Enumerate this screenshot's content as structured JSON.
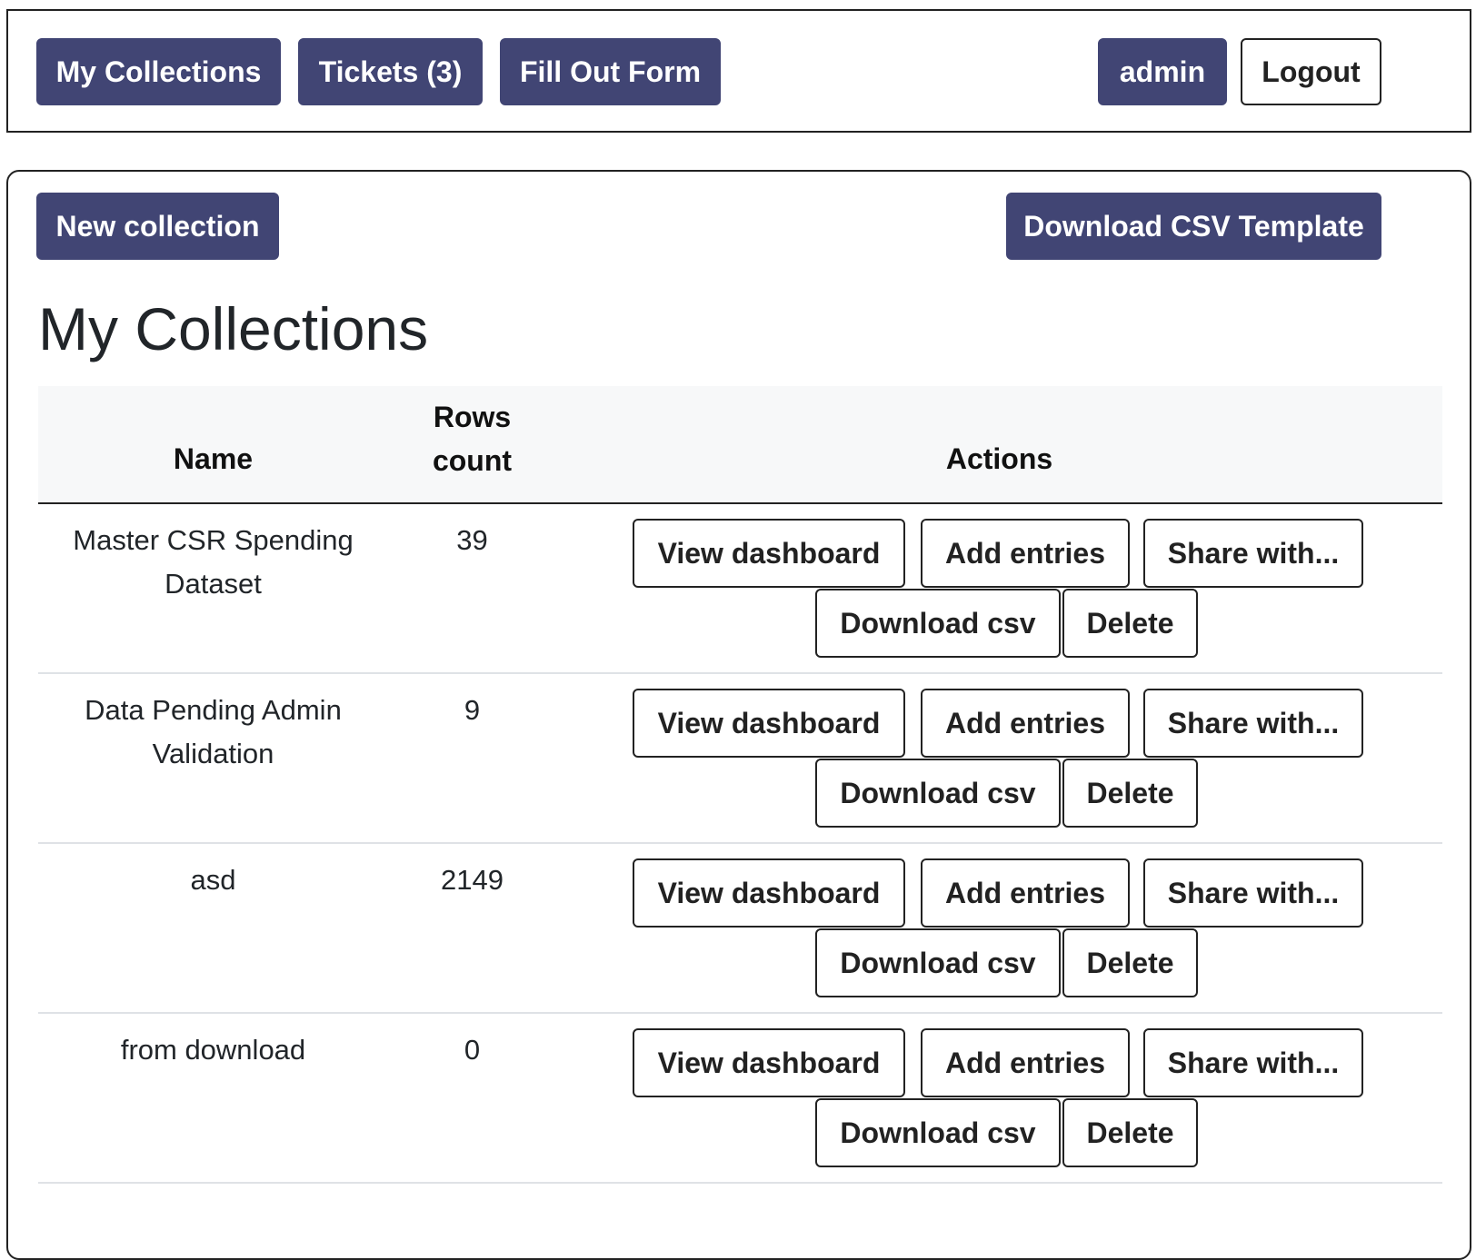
{
  "nav": {
    "my_collections": "My Collections",
    "tickets": "Tickets (3)",
    "fill_out_form": "Fill Out Form",
    "user": "admin",
    "logout": "Logout"
  },
  "toolbar": {
    "new_collection": "New collection",
    "download_template": "Download CSV Template"
  },
  "page": {
    "title": "My Collections"
  },
  "table": {
    "headers": {
      "name": "Name",
      "rows_count_line1": "Rows",
      "rows_count_line2": "count",
      "actions": "Actions"
    },
    "actions": {
      "view": "View dashboard",
      "add": "Add entries",
      "share": "Share with...",
      "download": "Download csv",
      "delete": "Delete"
    },
    "rows": [
      {
        "name": "Master CSR Spending Dataset",
        "count": "39"
      },
      {
        "name": "Data Pending Admin Validation",
        "count": "9"
      },
      {
        "name": "asd",
        "count": "2149"
      },
      {
        "name": "from download",
        "count": "0"
      }
    ]
  },
  "colors": {
    "primary": "#414574",
    "border": "#222222",
    "header_bg": "#f7f8f9",
    "row_divider": "#dfe2e6"
  }
}
